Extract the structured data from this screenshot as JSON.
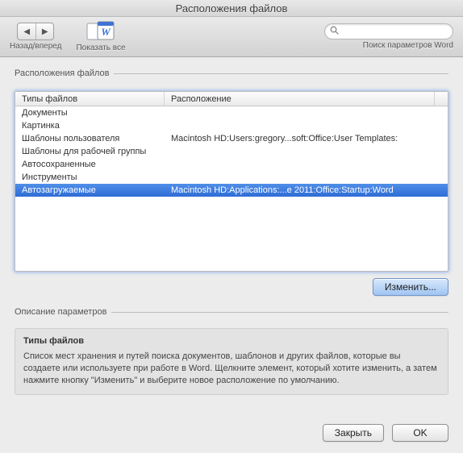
{
  "window": {
    "title": "Расположения файлов"
  },
  "toolbar": {
    "back_forward_label": "Назад/вперед",
    "show_all_label": "Показать все",
    "search_placeholder": "",
    "search_label": "Поиск параметров Word"
  },
  "panel": {
    "legend": "Расположения файлов",
    "columns": {
      "type": "Типы файлов",
      "location": "Расположение"
    },
    "rows": [
      {
        "type": "Документы",
        "location": ""
      },
      {
        "type": "Картинка",
        "location": ""
      },
      {
        "type": "Шаблоны пользователя",
        "location": "Macintosh HD:Users:gregory...soft:Office:User Templates:"
      },
      {
        "type": "Шаблоны для рабочей группы",
        "location": ""
      },
      {
        "type": "Автосохраненные",
        "location": ""
      },
      {
        "type": "Инструменты",
        "location": ""
      },
      {
        "type": "Автозагружаемые",
        "location": "Macintosh HD:Applications:...e 2011:Office:Startup:Word"
      }
    ],
    "selected_index": 6,
    "modify_button": "Изменить..."
  },
  "description": {
    "legend": "Описание параметров",
    "title": "Типы файлов",
    "body": "Список мест хранения и путей поиска документов, шаблонов и других файлов, которые вы создаете или используете при работе в Word. Щелкните элемент, который хотите изменить, а затем нажмите кнопку \"Изменить\" и выберите новое расположение по умолчанию."
  },
  "footer": {
    "close": "Закрыть",
    "ok": "OK"
  }
}
